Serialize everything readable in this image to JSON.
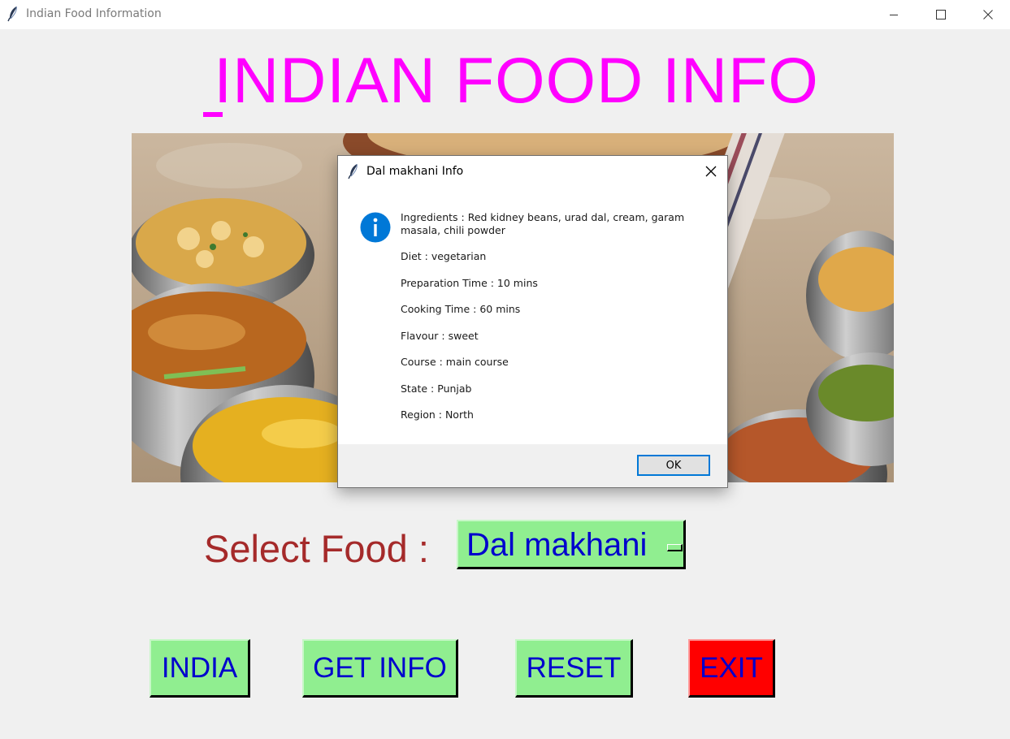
{
  "window": {
    "title": "Indian Food Information"
  },
  "app": {
    "title": "INDIAN FOOD INFO"
  },
  "select": {
    "label": "Select Food :",
    "value": "Dal makhani"
  },
  "buttons": {
    "india": "INDIA",
    "get_info": "GET INFO",
    "reset": "RESET",
    "exit": "EXIT"
  },
  "dialog": {
    "title": "Dal makhani  Info",
    "lines": [
      "Ingredients  :  Red kidney beans, urad dal, cream, garam masala, chili powder",
      "Diet  :  vegetarian",
      "Preparation Time  :  10 mins",
      "Cooking Time  :  60 mins",
      "Flavour  :  sweet",
      "Course  :  main course",
      "State  :  Punjab",
      "Region  :  North"
    ],
    "ok_label": "OK"
  },
  "colors": {
    "title": "#ff00ff",
    "label": "#a52a2a",
    "button_bg": "#90ee90",
    "button_text": "#0000cd",
    "exit_bg": "#ff0000",
    "info_icon": "#0078d7"
  },
  "icons": [
    "feather-icon",
    "minimize-icon",
    "maximize-icon",
    "close-icon",
    "info-icon",
    "dropdown-indicator-icon"
  ]
}
